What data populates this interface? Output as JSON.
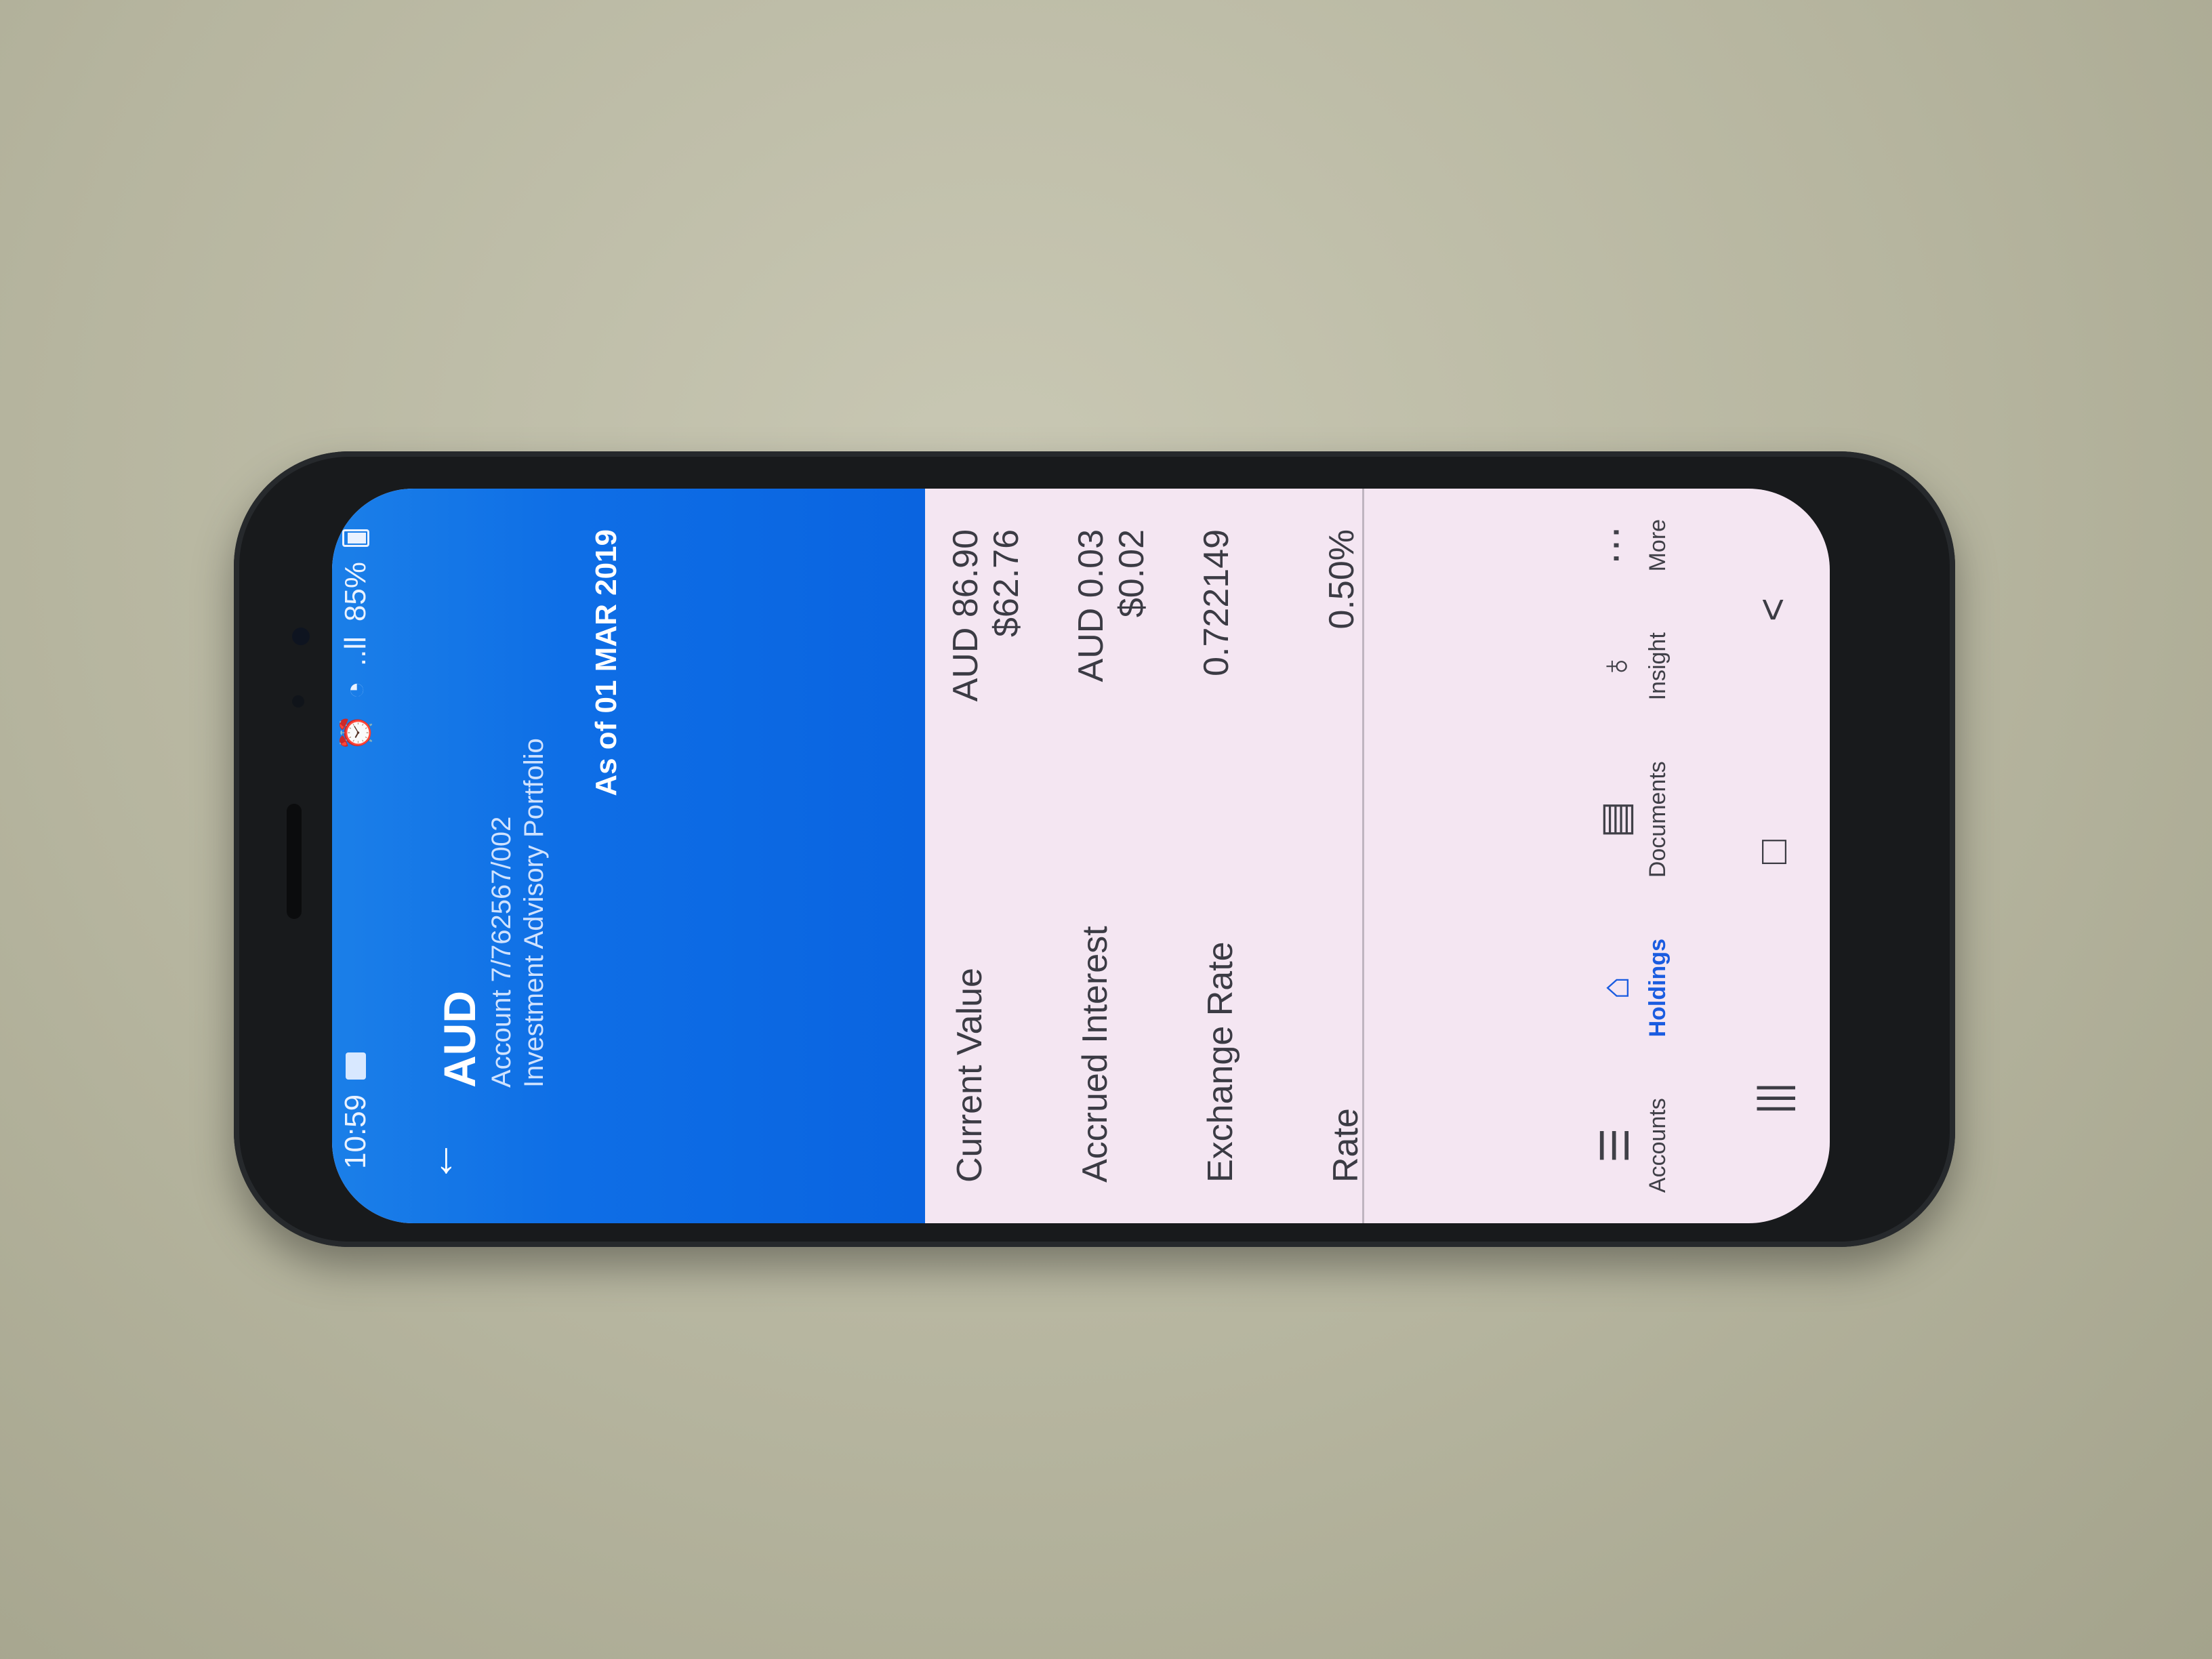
{
  "status_bar": {
    "time": "10:59",
    "battery": "85%",
    "signal": "..ll"
  },
  "header": {
    "back_icon": "arrow-left-icon",
    "currency": "AUD",
    "account": "Account 7/762567/002",
    "portfolio": "Investment Advisory Portfolio",
    "as_of": "As of 01 MAR 2019"
  },
  "rows": [
    {
      "label": "Current Value",
      "values": [
        "AUD 86.90",
        "$62.76"
      ]
    },
    {
      "label": "Accrued Interest",
      "values": [
        "AUD 0.03",
        "$0.02"
      ]
    },
    {
      "label": "Exchange Rate",
      "values": [
        "0.722149"
      ]
    },
    {
      "label": "Rate",
      "values": [
        "0.50%"
      ]
    }
  ],
  "bottom_nav": [
    {
      "label": "Accounts",
      "icon": "coins-icon",
      "active": false
    },
    {
      "label": "Holdings",
      "icon": "bank-icon",
      "active": true
    },
    {
      "label": "Documents",
      "icon": "document-icon",
      "active": false
    },
    {
      "label": "Insight",
      "icon": "lightbulb-icon",
      "active": false
    },
    {
      "label": "More",
      "icon": "more-dots-icon",
      "active": false
    }
  ],
  "system_nav": {
    "recent": "|||",
    "home": "□",
    "back": "<"
  },
  "colors": {
    "header_blue": "#0a64e0",
    "active_nav": "#1a5ce0",
    "screen_bg": "#f4e6f2"
  }
}
